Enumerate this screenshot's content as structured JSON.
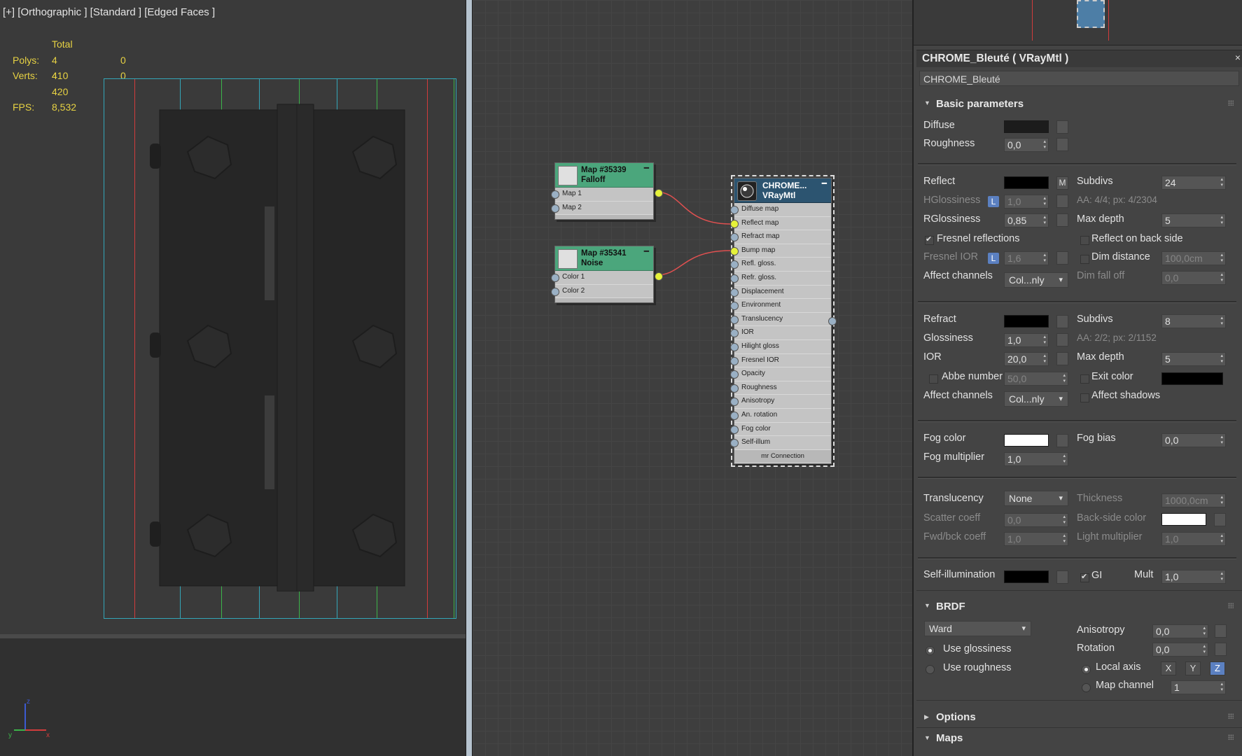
{
  "viewport": {
    "labels": [
      "[+]",
      "[Orthographic ]",
      "[Standard ]",
      "[Edged Faces ]"
    ],
    "stats": {
      "total_label": "Total",
      "polys_label": "Polys:",
      "polys_value": "4 410",
      "polys_sel": "0",
      "verts_label": "Verts:",
      "verts_value": "4 420",
      "verts_sel": "0",
      "fps_label": "FPS:",
      "fps_value": "8,532"
    },
    "axis": {
      "x": "x",
      "y": "y",
      "z": "z"
    }
  },
  "nodes": {
    "falloff": {
      "title1": "Map #35339",
      "title2": "Falloff",
      "slots": [
        "Map 1",
        "Map 2"
      ]
    },
    "noise": {
      "title1": "Map #35341",
      "title2": "Noise",
      "slots": [
        "Color 1",
        "Color 2"
      ]
    },
    "vray": {
      "title1": "CHROME...",
      "title2": "VRayMtl",
      "slots": [
        "Diffuse map",
        "Reflect map",
        "Refract map",
        "Bump map",
        "Refl. gloss.",
        "Refr. gloss.",
        "Displacement",
        "Environment",
        "Translucency",
        "IOR",
        "Hilight gloss",
        "Fresnel IOR",
        "Opacity",
        "Roughness",
        "Anisotropy",
        "An. rotation",
        "Fog color",
        "Self-illum"
      ],
      "footer": "mr Connection"
    }
  },
  "material": {
    "title": "CHROME_Bleuté  ( VRayMtl )",
    "close": "×",
    "name": "CHROME_Bleuté",
    "basic_header": "Basic parameters",
    "diffuse": {
      "label": "Diffuse",
      "color": "#1c1c1c"
    },
    "roughness": {
      "label": "Roughness",
      "value": "0,0"
    },
    "reflect": {
      "label": "Reflect",
      "color": "#000000",
      "map_btn": "M"
    },
    "refl_subdivs": {
      "label": "Subdivs",
      "value": "24"
    },
    "hglossiness": {
      "label": "HGlossiness",
      "lock": "L",
      "value": "1,0"
    },
    "refl_aa": "AA: 4/4; px: 4/2304",
    "rglossiness": {
      "label": "RGlossiness",
      "value": "0,85"
    },
    "refl_maxdepth": {
      "label": "Max depth",
      "value": "5"
    },
    "fresnel_reflections": {
      "label": "Fresnel reflections",
      "checked": true
    },
    "reflect_back": {
      "label": "Reflect on back side",
      "checked": false
    },
    "fresnel_ior": {
      "label": "Fresnel IOR",
      "lock": "L",
      "value": "1,6"
    },
    "dim_distance": {
      "label": "Dim distance",
      "checked": false,
      "value": "100,0cm"
    },
    "refl_affect": {
      "label": "Affect channels",
      "value": "Col...nly"
    },
    "dim_falloff": {
      "label": "Dim fall off",
      "value": "0,0"
    },
    "refract": {
      "label": "Refract",
      "color": "#000000"
    },
    "refr_subdivs": {
      "label": "Subdivs",
      "value": "8"
    },
    "glossiness": {
      "label": "Glossiness",
      "value": "1,0"
    },
    "refr_aa": "AA: 2/2; px: 2/1152",
    "ior": {
      "label": "IOR",
      "value": "20,0"
    },
    "refr_maxdepth": {
      "label": "Max depth",
      "value": "5"
    },
    "abbe": {
      "label": "Abbe number",
      "checked": false,
      "value": "50,0"
    },
    "exit_color": {
      "label": "Exit color",
      "checked": false,
      "color": "#000000"
    },
    "refr_affect": {
      "label": "Affect channels",
      "value": "Col...nly"
    },
    "affect_shadows": {
      "label": "Affect shadows",
      "checked": false
    },
    "fog_color": {
      "label": "Fog color",
      "color": "#ffffff"
    },
    "fog_bias": {
      "label": "Fog bias",
      "value": "0,0"
    },
    "fog_mult": {
      "label": "Fog multiplier",
      "value": "1,0"
    },
    "translucency": {
      "label": "Translucency",
      "value": "None"
    },
    "thickness": {
      "label": "Thickness",
      "value": "1000,0cm"
    },
    "scatter": {
      "label": "Scatter coeff",
      "value": "0,0"
    },
    "backside": {
      "label": "Back-side color",
      "color": "#ffffff"
    },
    "fwdbck": {
      "label": "Fwd/bck coeff",
      "value": "1,0"
    },
    "lightmult": {
      "label": "Light multiplier",
      "value": "1,0"
    },
    "selfillum": {
      "label": "Self-illumination",
      "color": "#000000"
    },
    "gi": {
      "label": "GI",
      "checked": true
    },
    "mult": {
      "label": "Mult",
      "value": "1,0"
    },
    "brdf_header": "BRDF",
    "brdf_type": "Ward",
    "anisotropy": {
      "label": "Anisotropy",
      "value": "0,0"
    },
    "rotation": {
      "label": "Rotation",
      "value": "0,0"
    },
    "use_glossiness": {
      "label": "Use glossiness",
      "selected": true
    },
    "use_roughness": {
      "label": "Use roughness",
      "selected": false
    },
    "local_axis": {
      "label": "Local axis",
      "selected": true,
      "axes": [
        "X",
        "Y",
        "Z"
      ],
      "active": "Z"
    },
    "map_channel": {
      "label": "Map channel",
      "selected": false,
      "value": "1"
    },
    "options_header": "Options",
    "maps_header": "Maps"
  },
  "colors": {
    "accent": "#5b80c1",
    "node_map": "#4ba67c",
    "node_mtl": "#2c5470",
    "stats": "#e7d243",
    "wire": "#e05050"
  }
}
